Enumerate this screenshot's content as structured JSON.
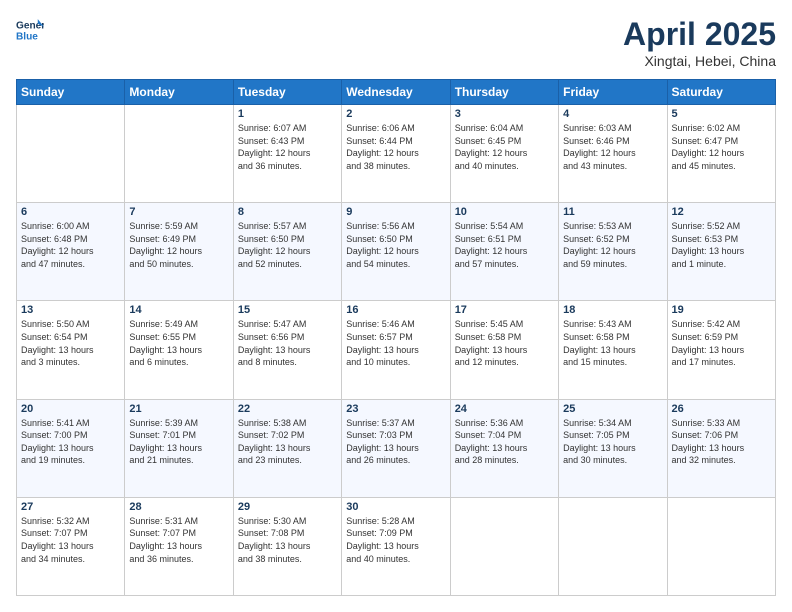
{
  "logo": {
    "line1": "General",
    "line2": "Blue"
  },
  "title": "April 2025",
  "subtitle": "Xingtai, Hebei, China",
  "weekdays": [
    "Sunday",
    "Monday",
    "Tuesday",
    "Wednesday",
    "Thursday",
    "Friday",
    "Saturday"
  ],
  "weeks": [
    [
      {
        "day": "",
        "info": ""
      },
      {
        "day": "",
        "info": ""
      },
      {
        "day": "1",
        "info": "Sunrise: 6:07 AM\nSunset: 6:43 PM\nDaylight: 12 hours\nand 36 minutes."
      },
      {
        "day": "2",
        "info": "Sunrise: 6:06 AM\nSunset: 6:44 PM\nDaylight: 12 hours\nand 38 minutes."
      },
      {
        "day": "3",
        "info": "Sunrise: 6:04 AM\nSunset: 6:45 PM\nDaylight: 12 hours\nand 40 minutes."
      },
      {
        "day": "4",
        "info": "Sunrise: 6:03 AM\nSunset: 6:46 PM\nDaylight: 12 hours\nand 43 minutes."
      },
      {
        "day": "5",
        "info": "Sunrise: 6:02 AM\nSunset: 6:47 PM\nDaylight: 12 hours\nand 45 minutes."
      }
    ],
    [
      {
        "day": "6",
        "info": "Sunrise: 6:00 AM\nSunset: 6:48 PM\nDaylight: 12 hours\nand 47 minutes."
      },
      {
        "day": "7",
        "info": "Sunrise: 5:59 AM\nSunset: 6:49 PM\nDaylight: 12 hours\nand 50 minutes."
      },
      {
        "day": "8",
        "info": "Sunrise: 5:57 AM\nSunset: 6:50 PM\nDaylight: 12 hours\nand 52 minutes."
      },
      {
        "day": "9",
        "info": "Sunrise: 5:56 AM\nSunset: 6:50 PM\nDaylight: 12 hours\nand 54 minutes."
      },
      {
        "day": "10",
        "info": "Sunrise: 5:54 AM\nSunset: 6:51 PM\nDaylight: 12 hours\nand 57 minutes."
      },
      {
        "day": "11",
        "info": "Sunrise: 5:53 AM\nSunset: 6:52 PM\nDaylight: 12 hours\nand 59 minutes."
      },
      {
        "day": "12",
        "info": "Sunrise: 5:52 AM\nSunset: 6:53 PM\nDaylight: 13 hours\nand 1 minute."
      }
    ],
    [
      {
        "day": "13",
        "info": "Sunrise: 5:50 AM\nSunset: 6:54 PM\nDaylight: 13 hours\nand 3 minutes."
      },
      {
        "day": "14",
        "info": "Sunrise: 5:49 AM\nSunset: 6:55 PM\nDaylight: 13 hours\nand 6 minutes."
      },
      {
        "day": "15",
        "info": "Sunrise: 5:47 AM\nSunset: 6:56 PM\nDaylight: 13 hours\nand 8 minutes."
      },
      {
        "day": "16",
        "info": "Sunrise: 5:46 AM\nSunset: 6:57 PM\nDaylight: 13 hours\nand 10 minutes."
      },
      {
        "day": "17",
        "info": "Sunrise: 5:45 AM\nSunset: 6:58 PM\nDaylight: 13 hours\nand 12 minutes."
      },
      {
        "day": "18",
        "info": "Sunrise: 5:43 AM\nSunset: 6:58 PM\nDaylight: 13 hours\nand 15 minutes."
      },
      {
        "day": "19",
        "info": "Sunrise: 5:42 AM\nSunset: 6:59 PM\nDaylight: 13 hours\nand 17 minutes."
      }
    ],
    [
      {
        "day": "20",
        "info": "Sunrise: 5:41 AM\nSunset: 7:00 PM\nDaylight: 13 hours\nand 19 minutes."
      },
      {
        "day": "21",
        "info": "Sunrise: 5:39 AM\nSunset: 7:01 PM\nDaylight: 13 hours\nand 21 minutes."
      },
      {
        "day": "22",
        "info": "Sunrise: 5:38 AM\nSunset: 7:02 PM\nDaylight: 13 hours\nand 23 minutes."
      },
      {
        "day": "23",
        "info": "Sunrise: 5:37 AM\nSunset: 7:03 PM\nDaylight: 13 hours\nand 26 minutes."
      },
      {
        "day": "24",
        "info": "Sunrise: 5:36 AM\nSunset: 7:04 PM\nDaylight: 13 hours\nand 28 minutes."
      },
      {
        "day": "25",
        "info": "Sunrise: 5:34 AM\nSunset: 7:05 PM\nDaylight: 13 hours\nand 30 minutes."
      },
      {
        "day": "26",
        "info": "Sunrise: 5:33 AM\nSunset: 7:06 PM\nDaylight: 13 hours\nand 32 minutes."
      }
    ],
    [
      {
        "day": "27",
        "info": "Sunrise: 5:32 AM\nSunset: 7:07 PM\nDaylight: 13 hours\nand 34 minutes."
      },
      {
        "day": "28",
        "info": "Sunrise: 5:31 AM\nSunset: 7:07 PM\nDaylight: 13 hours\nand 36 minutes."
      },
      {
        "day": "29",
        "info": "Sunrise: 5:30 AM\nSunset: 7:08 PM\nDaylight: 13 hours\nand 38 minutes."
      },
      {
        "day": "30",
        "info": "Sunrise: 5:28 AM\nSunset: 7:09 PM\nDaylight: 13 hours\nand 40 minutes."
      },
      {
        "day": "",
        "info": ""
      },
      {
        "day": "",
        "info": ""
      },
      {
        "day": "",
        "info": ""
      }
    ]
  ]
}
